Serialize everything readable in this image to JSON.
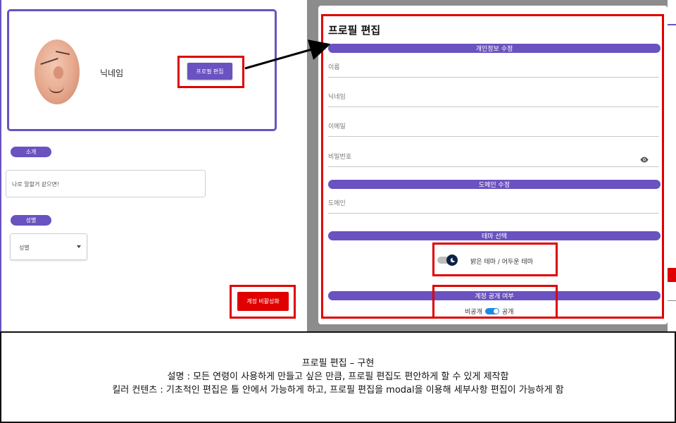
{
  "profile": {
    "nickname": "닉네임",
    "edit_button_label": "프로필 편집"
  },
  "intro": {
    "label": "소개",
    "value": "나로 말할거 같으면!"
  },
  "gender": {
    "label": "성별",
    "selected": "성별"
  },
  "deactivate_button_label": "계정 비활성화",
  "modal": {
    "title": "프로필 편집",
    "sections": {
      "personal": "개인정보 수정",
      "domain": "도메인 수정",
      "theme": "테마 선택",
      "visibility": "계정 공개 여부"
    },
    "fields": {
      "name": "이름",
      "nickname": "닉네임",
      "email": "이메일",
      "password": "비밀번호",
      "domain": "도메인"
    },
    "theme_label": "밝은 테마 / 어두운 테마",
    "visibility": {
      "private": "비공개",
      "public": "공개"
    }
  },
  "caption": {
    "title": "프로필 편집 – 구현",
    "description": "설명 : 모든 연령이 사용하게 만들고 싶은 만큼, 프로필 편집도 편안하게 할 수 있게 제작함",
    "killer": "킬러 컨텐츠 : 기초적인 편집은 틀 안에서 가능하게 하고, 프로필 편집을 modal을 이용해 세부사항 편집이 가능하게 함"
  },
  "colors": {
    "accent": "#6a52c0",
    "highlight": "#e00000",
    "overlay": "#8c8c8c",
    "toggle_on": "#1e88e5"
  }
}
